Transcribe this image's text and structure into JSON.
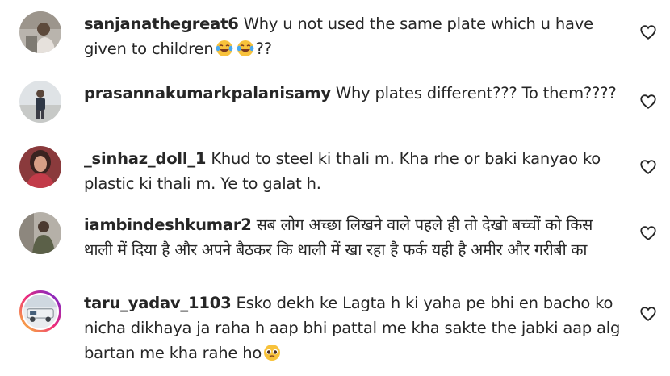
{
  "comments": [
    {
      "username": "sanjanathegreat6",
      "text": "Why u not used the same plate which u have given to children",
      "suffix": "??",
      "emojis": [
        "face-with-tears-of-joy",
        "face-with-tears-of-joy"
      ]
    },
    {
      "username": "prasannakumarkpalanisamy",
      "text": "Why plates different??? To them????"
    },
    {
      "username": "_sinhaz_doll_1",
      "text": "Khud to steel ki thali m. Kha rhe or baki kanyao ko plastic ki thali m. Ye to galat h."
    },
    {
      "username": "iambindeshkumar2",
      "text": "सब लोग अच्छा लिखने वाले पहले ही तो देखो बच्चों को किस थाली में दिया है और अपने बैठकर कि थाली में खा रहा है फर्क यही है अमीर और गरीबी का"
    },
    {
      "username": "taru_yadav_1103",
      "text": "Esko dekh ke Lagta h ki yaha pe bhi en bacho ko nicha dikhaya ja raha h aap bhi pattal me kha sakte the jabki aap alg bartan me kha rahe ho",
      "emojis": [
        "pleading-face"
      ]
    }
  ],
  "icons": {
    "like": "heart-outline-icon"
  },
  "colors": {
    "text": "#262626",
    "icon_stroke": "#262626",
    "story_ring": [
      "#f9ce34",
      "#ee2a7b",
      "#6228d7"
    ]
  }
}
